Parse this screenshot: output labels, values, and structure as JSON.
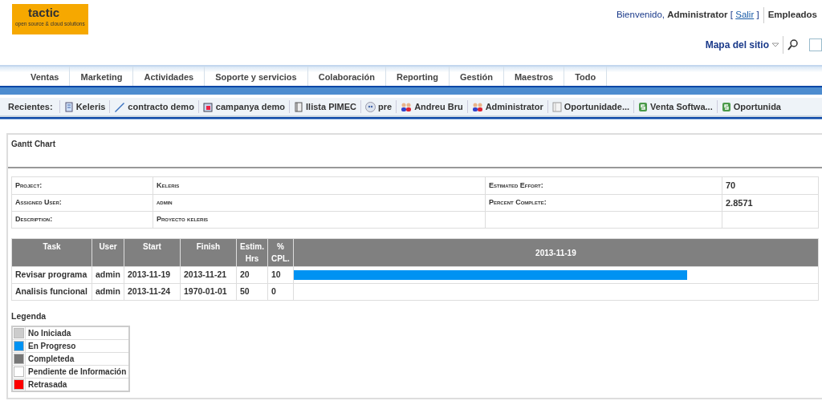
{
  "logo": {
    "name": "tactic",
    "tagline": "open source & cloud solutions"
  },
  "header": {
    "welcome": "Bienvenido,",
    "user": "Administrator",
    "logout_open": "[",
    "logout": "Salir",
    "logout_close": "]",
    "module": "Empleados",
    "sitemap": "Mapa del sitio"
  },
  "menu": [
    {
      "label": "Ventas"
    },
    {
      "label": "Marketing"
    },
    {
      "label": "Actividades"
    },
    {
      "label": "Soporte y servicios"
    },
    {
      "label": "Colaboración"
    },
    {
      "label": "Reporting"
    },
    {
      "label": "Gestión"
    },
    {
      "label": "Maestros"
    },
    {
      "label": "Todo"
    }
  ],
  "recent": {
    "label": "Recientes:",
    "items": [
      {
        "label": "Keleris",
        "kind": "project"
      },
      {
        "label": "contracto demo",
        "kind": "pen"
      },
      {
        "label": "campanya demo",
        "kind": "campaign"
      },
      {
        "label": "llista PIMEC",
        "kind": "book"
      },
      {
        "label": "pre",
        "kind": "quote"
      },
      {
        "label": "Andreu Bru",
        "kind": "users"
      },
      {
        "label": "Administrator",
        "kind": "users"
      },
      {
        "label": "Oportunidade...",
        "kind": "document"
      },
      {
        "label": "Venta Softwa...",
        "kind": "money"
      },
      {
        "label": "Oportunida",
        "kind": "money"
      }
    ]
  },
  "panel": {
    "title": "Gantt Chart",
    "details": [
      {
        "label": "Project:",
        "value": "Keleris",
        "label2": "Estimated Effort:",
        "value2": "70"
      },
      {
        "label": "Assigned User:",
        "value": "admin",
        "label2": "Percent Complete:",
        "value2": "2.8571"
      },
      {
        "label": "Description:",
        "value": "Proyecto keleris"
      }
    ],
    "gantt": {
      "columns": [
        "Task",
        "User",
        "Start",
        "Finish",
        "Estim. Hrs",
        "% CPL.",
        "2013-11-19"
      ],
      "rows": [
        {
          "cells": [
            "Revisar programa",
            "admin",
            "2013-11-19",
            "2013-11-21",
            "20",
            "10"
          ],
          "level": 0.75,
          "color": "#0092f2"
        },
        {
          "cells": [
            "Analisis funcional",
            "admin",
            "2013-11-24",
            "1970-01-01",
            "50",
            "0"
          ]
        }
      ]
    },
    "legend": {
      "title": "Legenda",
      "items": [
        {
          "label": "No Iniciada",
          "color": "#cccccc"
        },
        {
          "label": "En Progreso",
          "color": "#0092f2"
        },
        {
          "label": "Completeda",
          "color": "#777777"
        },
        {
          "label": "Pendiente de Información",
          "color": "#ffffff"
        },
        {
          "label": "Retrasada",
          "color": "#ff0000"
        }
      ]
    }
  }
}
